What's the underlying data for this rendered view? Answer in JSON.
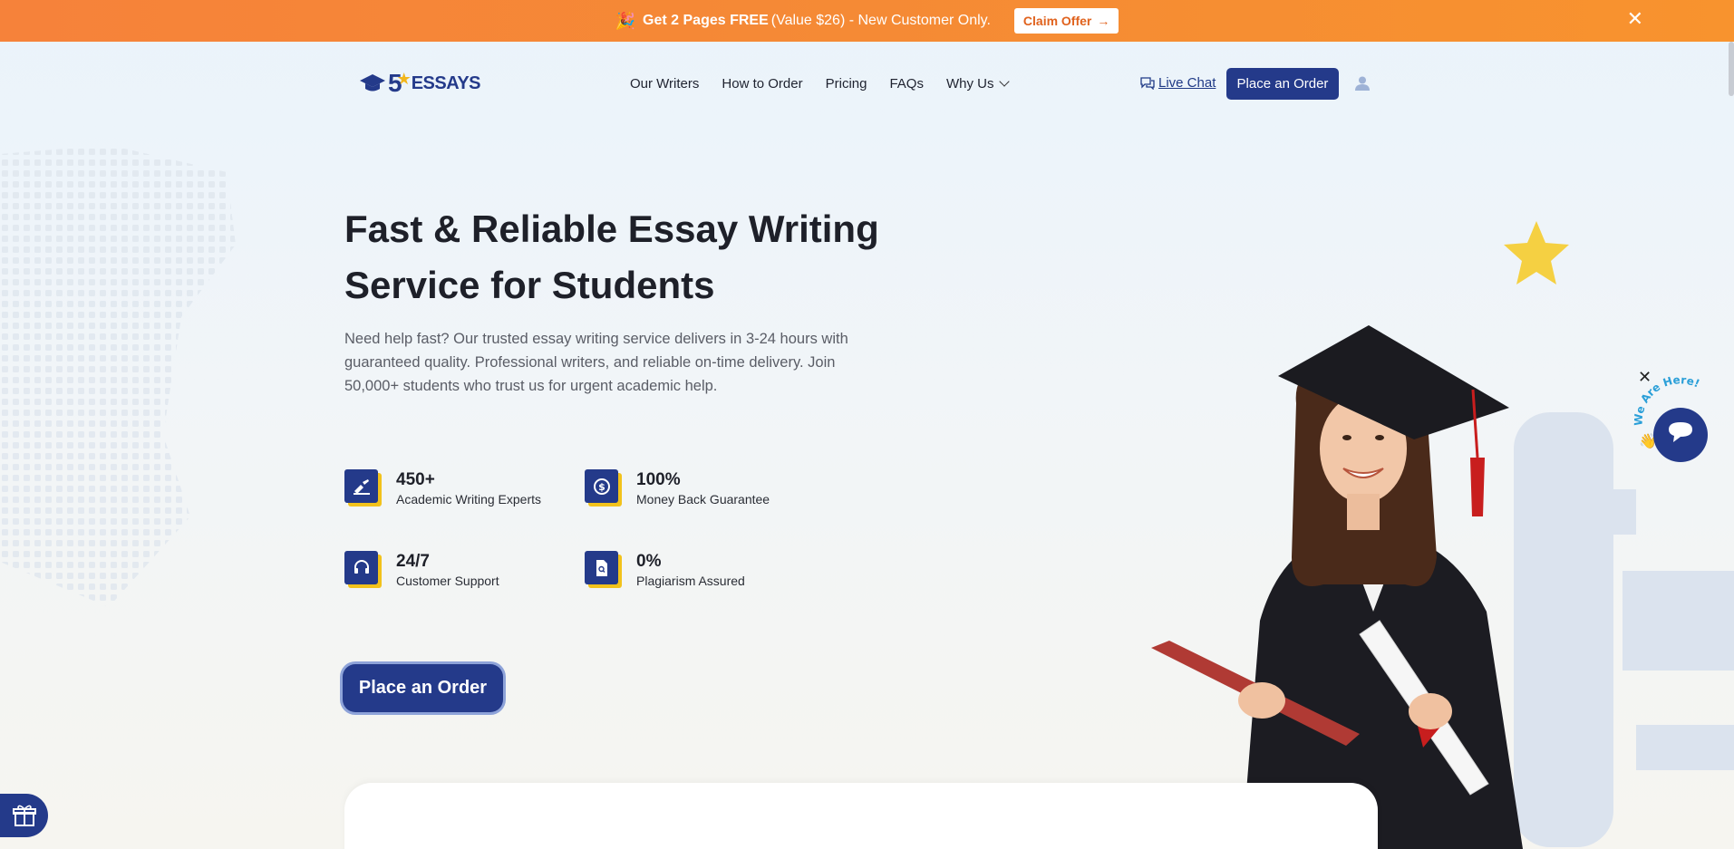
{
  "promo": {
    "strong": "Get 2 Pages FREE",
    "rest": " (Value $26) - New Customer Only.",
    "claim_label": "Claim Offer",
    "close": "✕"
  },
  "header": {
    "logo_five": "5",
    "logo_essays": "ESSAYS",
    "nav": [
      "Our Writers",
      "How to Order",
      "Pricing",
      "FAQs",
      "Why Us"
    ],
    "live_chat": "Live Chat",
    "order_label": "Place an Order"
  },
  "hero": {
    "title": "Fast & Reliable Essay Writing Service for Students",
    "description": "Need help fast? Our trusted essay writing service delivers in 3-24 hours with guaranteed quality. Professional writers, and reliable on-time delivery. Join 50,000+ students who trust us for urgent academic help.",
    "stats": [
      {
        "value": "450+",
        "label": "Academic Writing Experts",
        "icon": "writing-hand-icon"
      },
      {
        "value": "100%",
        "label": "Money Back Guarantee",
        "icon": "money-back-icon"
      },
      {
        "value": "24/7",
        "label": "Customer Support",
        "icon": "headset-icon"
      },
      {
        "value": "0%",
        "label": "Plagiarism Assured",
        "icon": "document-search-icon"
      }
    ],
    "order_label": "Place an Order"
  },
  "chat": {
    "badge_text": "We Are Here!",
    "close": "✕"
  },
  "colors": {
    "brand_navy": "#243a8a",
    "accent_yellow": "#f2c21b",
    "promo_orange": "#f6823a"
  }
}
